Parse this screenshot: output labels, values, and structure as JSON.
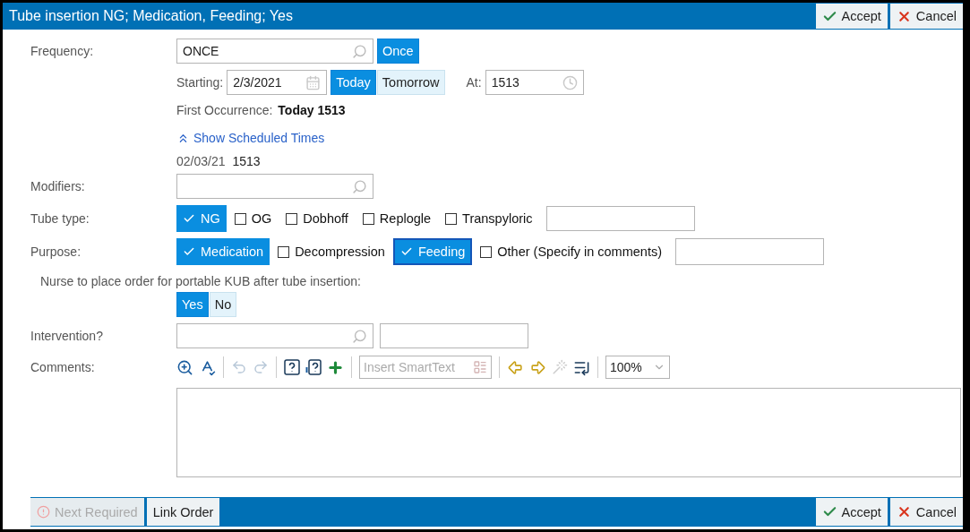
{
  "title": "Tube insertion NG; Medication, Feeding; Yes",
  "header_buttons": [
    {
      "label": "Accept",
      "kind": "accept"
    },
    {
      "label": "Cancel",
      "kind": "cancel"
    }
  ],
  "frequency": {
    "label": "Frequency:",
    "value": "ONCE",
    "button": {
      "label": "Once",
      "selected": true
    }
  },
  "starting": {
    "label": "Starting:",
    "value": "2/3/2021",
    "buttons": [
      {
        "label": "Today",
        "selected": true
      },
      {
        "label": "Tomorrow",
        "selected": false
      }
    ],
    "at_label": "At:",
    "at_value": "1513"
  },
  "first_occurrence": {
    "label": "First Occurrence:",
    "value": "Today 1513"
  },
  "scheduled": {
    "toggle": "Show Scheduled Times",
    "expanded": true,
    "times": [
      {
        "date": "02/03/21",
        "time": "1513"
      }
    ]
  },
  "modifiers": {
    "label": "Modifiers:"
  },
  "tube_type": {
    "label": "Tube type:",
    "options": [
      {
        "label": "NG",
        "checked": true,
        "focused": false
      },
      {
        "label": "OG",
        "checked": false,
        "focused": false
      },
      {
        "label": "Dobhoff",
        "checked": false,
        "focused": false
      },
      {
        "label": "Replogle",
        "checked": false,
        "focused": false
      },
      {
        "label": "Transpyloric",
        "checked": false,
        "focused": false
      }
    ]
  },
  "purpose": {
    "label": "Purpose:",
    "options": [
      {
        "label": "Medication",
        "checked": true,
        "focused": false
      },
      {
        "label": "Decompression",
        "checked": false,
        "focused": false
      },
      {
        "label": "Feeding",
        "checked": true,
        "focused": true
      },
      {
        "label": "Other (Specify in comments)",
        "checked": false,
        "focused": false
      }
    ]
  },
  "kub": {
    "question": "Nurse to place order for portable KUB after tube insertion:",
    "options": [
      {
        "label": "Yes",
        "selected": true
      },
      {
        "label": "No",
        "selected": false
      }
    ]
  },
  "intervention": {
    "label": "Intervention?"
  },
  "comments": {
    "label": "Comments:",
    "smarttext_placeholder": "Insert SmartText",
    "zoom": "100%"
  },
  "footer": {
    "left_buttons": [
      {
        "label": "Next Required",
        "disabled": true,
        "kind": "required"
      },
      {
        "label": "Link Order",
        "disabled": false,
        "kind": "plain"
      }
    ],
    "right_buttons": [
      {
        "label": "Accept",
        "kind": "accept"
      },
      {
        "label": "Cancel",
        "kind": "cancel"
      }
    ]
  }
}
